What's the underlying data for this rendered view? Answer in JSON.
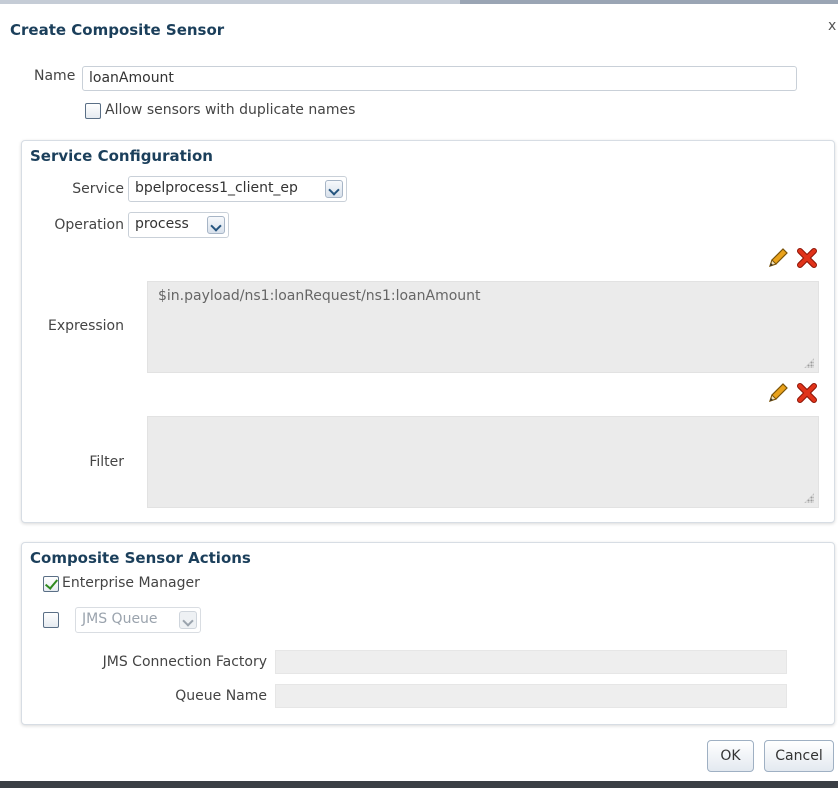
{
  "dialog": {
    "title": "Create Composite Sensor",
    "close_glyph": "x"
  },
  "name_field": {
    "label": "Name",
    "value": "loanAmount"
  },
  "duplicate_checkbox": {
    "label": "Allow sensors with duplicate names",
    "checked": false
  },
  "service_configuration": {
    "title": "Service Configuration",
    "service": {
      "label": "Service",
      "value": "bpelprocess1_client_ep"
    },
    "operation": {
      "label": "Operation",
      "value": "process"
    },
    "expression": {
      "label": "Expression",
      "value": "$in.payload/ns1:loanRequest/ns1:loanAmount",
      "icons": [
        "edit-pencil-icon",
        "delete-x-icon"
      ]
    },
    "filter": {
      "label": "Filter",
      "value": "",
      "icons": [
        "edit-pencil-icon",
        "delete-x-icon"
      ]
    }
  },
  "composite_sensor_actions": {
    "title": "Composite Sensor Actions",
    "enterprise_manager": {
      "label": "Enterprise Manager",
      "checked": true
    },
    "jms": {
      "checked": false,
      "select_value": "JMS Queue",
      "disabled": true
    },
    "jms_connection_factory": {
      "label": "JMS Connection Factory",
      "value": ""
    },
    "queue_name": {
      "label": "Queue Name",
      "value": ""
    }
  },
  "buttons": {
    "ok": "OK",
    "cancel": "Cancel"
  },
  "colors": {
    "title": "#1b3f5b",
    "check": "#2f8a1f",
    "delete": "#d62a12",
    "pencil": "#e9a21b"
  }
}
